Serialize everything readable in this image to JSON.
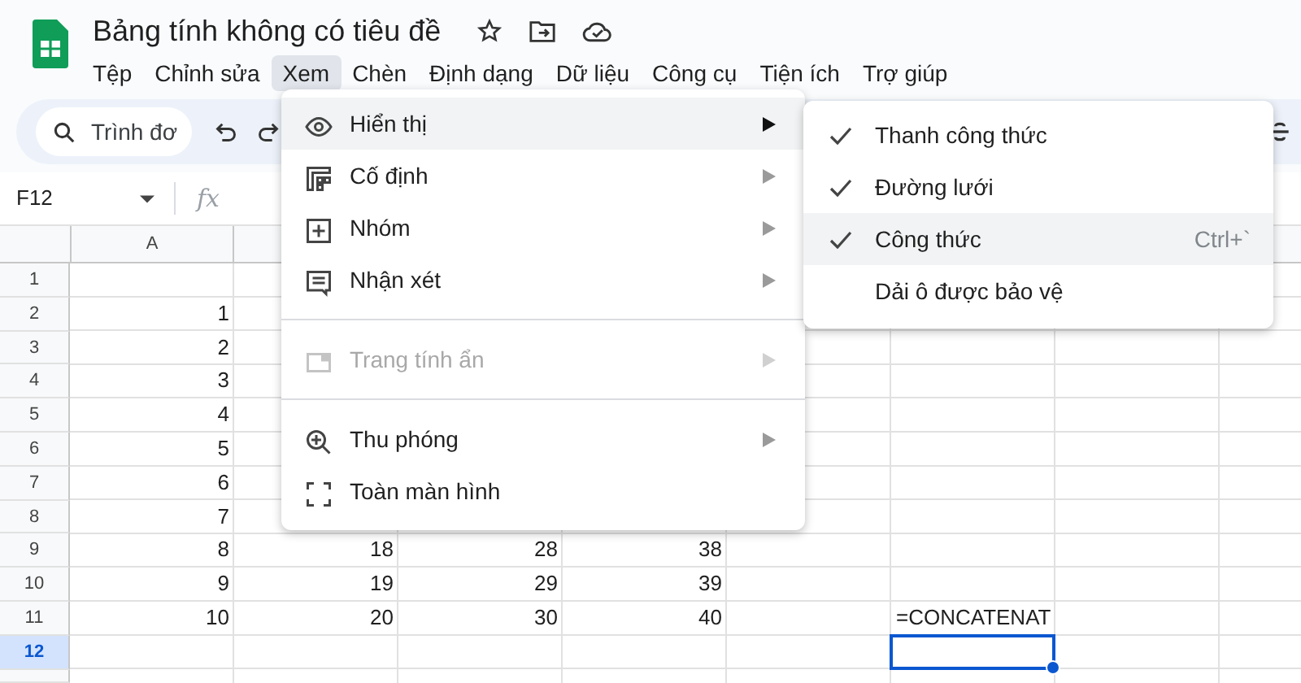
{
  "app": {
    "title": "Bảng tính không có tiêu đề"
  },
  "menu_bar": [
    {
      "label": "Tệp",
      "selected": false
    },
    {
      "label": "Chỉnh sửa",
      "selected": false
    },
    {
      "label": "Xem",
      "selected": true
    },
    {
      "label": "Chèn",
      "selected": false
    },
    {
      "label": "Định dạng",
      "selected": false
    },
    {
      "label": "Dữ liệu",
      "selected": false
    },
    {
      "label": "Công cụ",
      "selected": false
    },
    {
      "label": "Tiện ích",
      "selected": false
    },
    {
      "label": "Trợ giúp",
      "selected": false
    }
  ],
  "toolbar": {
    "search": {
      "placeholder": "Trình đơ"
    }
  },
  "formula_bar": {
    "name_box": "F12",
    "fx": "fx"
  },
  "sheet": {
    "column_headers": [
      "A"
    ],
    "rows": [
      {
        "header": "1",
        "selected": false
      },
      {
        "header": "2",
        "selected": false,
        "cells": [
          {
            "kind": "number",
            "text": "1"
          }
        ]
      },
      {
        "header": "3",
        "selected": false,
        "cells": [
          {
            "kind": "number",
            "text": "2"
          }
        ]
      },
      {
        "header": "4",
        "selected": false,
        "cells": [
          {
            "kind": "number",
            "text": "3"
          }
        ]
      },
      {
        "header": "5",
        "selected": false,
        "cells": [
          {
            "kind": "number",
            "text": "4"
          }
        ]
      },
      {
        "header": "6",
        "selected": false,
        "cells": [
          {
            "kind": "number",
            "text": "5"
          }
        ]
      },
      {
        "header": "7",
        "selected": false,
        "cells": [
          {
            "kind": "number",
            "text": "6"
          }
        ]
      },
      {
        "header": "8",
        "selected": false,
        "cells": [
          {
            "kind": "number",
            "text": "7"
          }
        ]
      },
      {
        "header": "9",
        "selected": false,
        "cells": [
          {
            "kind": "number",
            "text": "8"
          },
          {
            "kind": "number",
            "text": "18"
          },
          {
            "kind": "number",
            "text": "28"
          },
          {
            "kind": "number",
            "text": "38"
          }
        ]
      },
      {
        "header": "10",
        "selected": false,
        "cells": [
          {
            "kind": "number",
            "text": "9"
          },
          {
            "kind": "number",
            "text": "19"
          },
          {
            "kind": "number",
            "text": "29"
          },
          {
            "kind": "number",
            "text": "39"
          }
        ]
      },
      {
        "header": "11",
        "selected": false,
        "cells": [
          {
            "kind": "number",
            "text": "10"
          },
          {
            "kind": "number",
            "text": "20"
          },
          {
            "kind": "number",
            "text": "30"
          },
          {
            "kind": "number",
            "text": "40"
          },
          {
            "kind": "empty"
          },
          {
            "kind": "text",
            "text": "=CONCATENAT"
          }
        ]
      },
      {
        "header": "12",
        "selected": true,
        "cells": [
          {
            "kind": "empty"
          },
          {
            "kind": "empty"
          },
          {
            "kind": "empty"
          },
          {
            "kind": "empty"
          },
          {
            "kind": "empty"
          },
          {
            "kind": "active"
          }
        ]
      }
    ]
  },
  "view_menu": {
    "items": [
      {
        "kind": "item",
        "label": "Hiển thị",
        "has_submenu": true,
        "selected": true,
        "disabled": false
      },
      {
        "kind": "item",
        "label": "Cố định",
        "has_submenu": true,
        "selected": false,
        "disabled": false
      },
      {
        "kind": "item",
        "label": "Nhóm",
        "has_submenu": true,
        "selected": false,
        "disabled": false
      },
      {
        "kind": "item",
        "label": "Nhận xét",
        "has_submenu": true,
        "selected": false,
        "disabled": false
      },
      {
        "kind": "divider"
      },
      {
        "kind": "item",
        "label": "Trang tính ẩn",
        "has_submenu": true,
        "selected": false,
        "disabled": true
      },
      {
        "kind": "divider"
      },
      {
        "kind": "item",
        "label": "Thu phóng",
        "has_submenu": true,
        "selected": false,
        "disabled": false
      },
      {
        "kind": "item",
        "label": "Toàn màn hình",
        "has_submenu": false,
        "selected": false,
        "disabled": false
      }
    ]
  },
  "show_submenu": {
    "items": [
      {
        "label": "Thanh công thức",
        "checked": true,
        "selected": false
      },
      {
        "label": "Đường lưới",
        "checked": true,
        "selected": false
      },
      {
        "label": "Công thức",
        "checked": true,
        "selected": true,
        "shortcut": "Ctrl+`"
      },
      {
        "label": "Dải ô được bảo vệ",
        "checked": false,
        "selected": false
      }
    ]
  }
}
